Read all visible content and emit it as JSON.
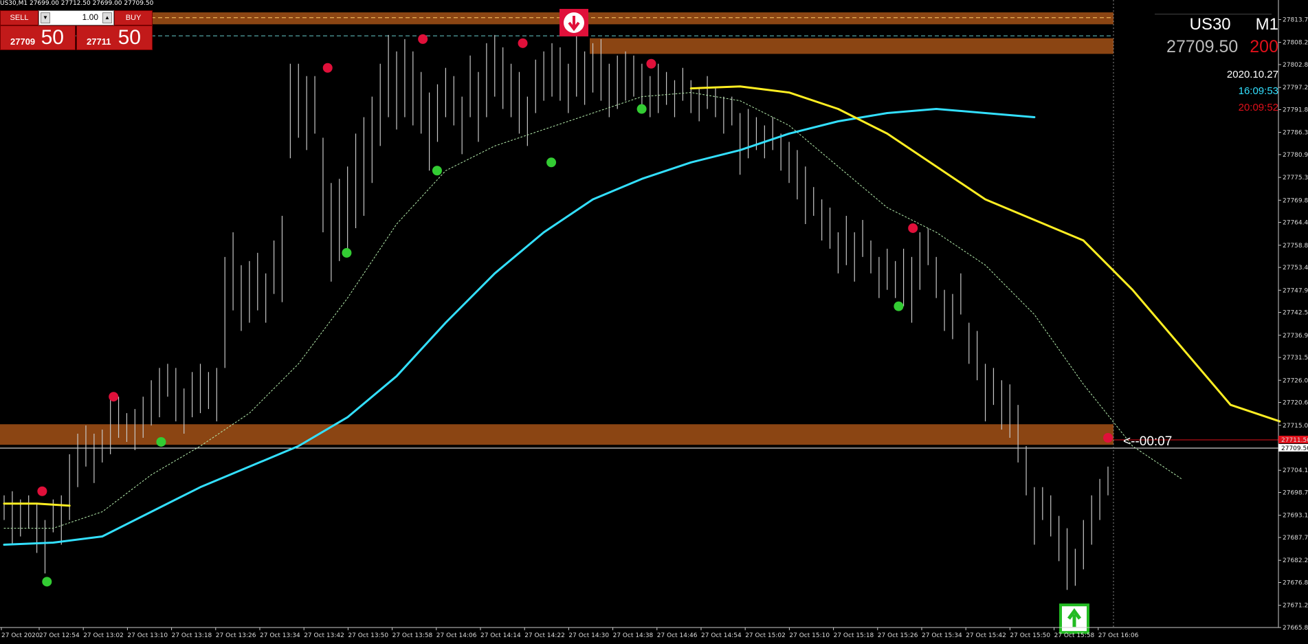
{
  "header": {
    "info_line": "US30,M1  27699.00 27712.50 27699.00 27709.50"
  },
  "trade_panel": {
    "sell_label": "SELL",
    "buy_label": "BUY",
    "lot_value": "1.00",
    "bid_small": "27709",
    "bid_big": "50",
    "ask_small": "27711",
    "ask_big": "50"
  },
  "symbol_info": {
    "symbol": "US30",
    "timeframe": "M1",
    "price": "27709.50",
    "spread": "200",
    "date": "2020.10.27",
    "time_server": "16:09:53",
    "time_local": "20:09:52"
  },
  "countdown": "<--00:07",
  "colors": {
    "background": "#000000",
    "zone": "#8b4513",
    "fast_ma": "#33e0ff",
    "slow_ma": "#ffee22",
    "dotted_ma": "#b8f0b0",
    "buy_dot": "#33cc33",
    "sell_dot": "#e0103a",
    "bars": "#c8c8c8"
  },
  "chart_data": {
    "type": "bar",
    "title": "",
    "ylim": [
      27665.85,
      27815.5
    ],
    "y_ticks": [
      "27813.75",
      "27808.20",
      "27802.80",
      "27797.25",
      "27791.85",
      "27786.30",
      "27780.90",
      "27775.35",
      "27769.80",
      "27764.40",
      "27758.85",
      "27753.45",
      "27747.90",
      "27742.50",
      "27736.95",
      "27731.55",
      "27726.00",
      "27720.60",
      "27715.05",
      "27709.50",
      "27704.10",
      "27698.70",
      "27693.15",
      "27687.75",
      "27682.20",
      "27676.80",
      "27671.25",
      "27665.85"
    ],
    "x_labels": [
      "27 Oct 2020",
      "27 Oct 12:54",
      "27 Oct 13:02",
      "27 Oct 13:10",
      "27 Oct 13:18",
      "27 Oct 13:26",
      "27 Oct 13:34",
      "27 Oct 13:42",
      "27 Oct 13:50",
      "27 Oct 13:58",
      "27 Oct 14:06",
      "27 Oct 14:14",
      "27 Oct 14:22",
      "27 Oct 14:30",
      "27 Oct 14:38",
      "27 Oct 14:46",
      "27 Oct 14:54",
      "27 Oct 15:02",
      "27 Oct 15:10",
      "27 Oct 15:18",
      "27 Oct 15:26",
      "27 Oct 15:34",
      "27 Oct 15:42",
      "27 Oct 15:50",
      "27 Oct 15:58",
      "27 Oct 16:06"
    ],
    "current_price": 27709.5,
    "ask_price": 27711.5,
    "zones": [
      [
        27812.6,
        27815.5
      ],
      [
        27805.4,
        27809.2
      ],
      [
        27710.3,
        27715.3
      ]
    ],
    "dashed_lines": [
      27814.2,
      27809.8
    ],
    "bar_ranges": [
      [
        27692,
        27698
      ],
      [
        27686,
        27699
      ],
      [
        27688,
        27697
      ],
      [
        27690,
        27698
      ],
      [
        27684,
        27696
      ],
      [
        27679,
        27692
      ],
      [
        27689,
        27697
      ],
      [
        27686,
        27698
      ],
      [
        27692,
        27708
      ],
      [
        27700,
        27713
      ],
      [
        27705,
        27715
      ],
      [
        27701,
        27713
      ],
      [
        27706,
        27714
      ],
      [
        27708,
        27722
      ],
      [
        27712,
        27722
      ],
      [
        27711,
        27718
      ],
      [
        27709,
        27719
      ],
      [
        27712,
        27722
      ],
      [
        27715,
        27726
      ],
      [
        27717,
        27729
      ],
      [
        27722,
        27730
      ],
      [
        27716,
        27729
      ],
      [
        27713,
        27724
      ],
      [
        27717,
        27728
      ],
      [
        27718,
        27730
      ],
      [
        27719,
        27728
      ],
      [
        27716,
        27729
      ],
      [
        27729,
        27756
      ],
      [
        27743,
        27762
      ],
      [
        27738,
        27754
      ],
      [
        27740,
        27755
      ],
      [
        27743,
        27757
      ],
      [
        27740,
        27752
      ],
      [
        27747,
        27760
      ],
      [
        27745,
        27766
      ],
      [
        27780,
        27803
      ],
      [
        27785,
        27803
      ],
      [
        27782,
        27800
      ],
      [
        27786,
        27800
      ],
      [
        27762,
        27785
      ],
      [
        27750,
        27774
      ],
      [
        27755,
        27775
      ],
      [
        27758,
        27778
      ],
      [
        27763,
        27786
      ],
      [
        27766,
        27790
      ],
      [
        27774,
        27795
      ],
      [
        27783,
        27803
      ],
      [
        27790,
        27810
      ],
      [
        27787,
        27806
      ],
      [
        27790,
        27809
      ],
      [
        27788,
        27806
      ],
      [
        27786,
        27801
      ],
      [
        27777,
        27796
      ],
      [
        27784,
        27798
      ],
      [
        27790,
        27802
      ],
      [
        27788,
        27800
      ],
      [
        27781,
        27795
      ],
      [
        27790,
        27805
      ],
      [
        27784,
        27801
      ],
      [
        27790,
        27808
      ],
      [
        27795,
        27810
      ],
      [
        27792,
        27807
      ],
      [
        27790,
        27803
      ],
      [
        27786,
        27801
      ],
      [
        27783,
        27795
      ],
      [
        27791,
        27804
      ],
      [
        27794,
        27806
      ],
      [
        27795,
        27808
      ],
      [
        27794,
        27807
      ],
      [
        27791,
        27803
      ],
      [
        27795,
        27810
      ],
      [
        27793,
        27806
      ],
      [
        27796,
        27808
      ],
      [
        27794,
        27809
      ],
      [
        27790,
        27803
      ],
      [
        27792,
        27805
      ],
      [
        27794,
        27806
      ],
      [
        27795,
        27805
      ],
      [
        27792,
        27803
      ],
      [
        27790,
        27800
      ],
      [
        27791,
        27803
      ],
      [
        27793,
        27801
      ],
      [
        27790,
        27799
      ],
      [
        27794,
        27802
      ],
      [
        27791,
        27799
      ],
      [
        27789,
        27797
      ],
      [
        27792,
        27800
      ],
      [
        27790,
        27797
      ],
      [
        27786,
        27795
      ],
      [
        27788,
        27795
      ],
      [
        27776,
        27791
      ],
      [
        27780,
        27792
      ],
      [
        27782,
        27790
      ],
      [
        27780,
        27788
      ],
      [
        27782,
        27790
      ],
      [
        27777,
        27786
      ],
      [
        27774,
        27784
      ],
      [
        27770,
        27782
      ],
      [
        27764,
        27778
      ],
      [
        27766,
        27773
      ],
      [
        27760,
        27770
      ],
      [
        27758,
        27768
      ],
      [
        27752,
        27762
      ],
      [
        27754,
        27766
      ],
      [
        27750,
        27762
      ],
      [
        27756,
        27765
      ],
      [
        27752,
        27760
      ],
      [
        27746,
        27756
      ],
      [
        27748,
        27758
      ],
      [
        27746,
        27755
      ],
      [
        27744,
        27758
      ],
      [
        27740,
        27756
      ],
      [
        27748,
        27762
      ],
      [
        27754,
        27763
      ],
      [
        27746,
        27756
      ],
      [
        27738,
        27748
      ],
      [
        27736,
        27747
      ],
      [
        27742,
        27752
      ],
      [
        27730,
        27740
      ],
      [
        27726,
        27738
      ],
      [
        27716,
        27730
      ],
      [
        27720,
        27729
      ],
      [
        27714,
        27726
      ],
      [
        27712,
        27725
      ],
      [
        27706,
        27720
      ],
      [
        27698,
        27710
      ],
      [
        27686,
        27700
      ],
      [
        27692,
        27700
      ],
      [
        27688,
        27698
      ],
      [
        27682,
        27693
      ],
      [
        27675,
        27690
      ],
      [
        27676,
        27685
      ],
      [
        27680,
        27692
      ],
      [
        27686,
        27698
      ],
      [
        27692,
        27702
      ],
      [
        27698,
        27705
      ]
    ],
    "fast_ma_points": [
      [
        0,
        27686
      ],
      [
        6,
        27686.5
      ],
      [
        12,
        27688
      ],
      [
        18,
        27694
      ],
      [
        24,
        27700
      ],
      [
        30,
        27705
      ],
      [
        36,
        27710
      ],
      [
        42,
        27717
      ],
      [
        48,
        27727
      ],
      [
        54,
        27740
      ],
      [
        60,
        27752
      ],
      [
        66,
        27762
      ],
      [
        72,
        27770
      ],
      [
        78,
        27775
      ],
      [
        84,
        27779
      ],
      [
        90,
        27782
      ],
      [
        96,
        27786
      ],
      [
        102,
        27789
      ],
      [
        108,
        27791
      ],
      [
        114,
        27792
      ],
      [
        120,
        27791
      ],
      [
        126,
        27790
      ]
    ],
    "slow_ma_points": [
      [
        84,
        27797
      ],
      [
        90,
        27797.5
      ],
      [
        96,
        27796
      ],
      [
        102,
        27792
      ],
      [
        108,
        27786
      ],
      [
        114,
        27778
      ],
      [
        120,
        27770
      ],
      [
        126,
        27765
      ],
      [
        132,
        27760
      ],
      [
        138,
        27748
      ],
      [
        144,
        27734
      ],
      [
        150,
        27720
      ],
      [
        156,
        27716
      ]
    ],
    "slow_ma_left": [
      [
        0,
        27696
      ],
      [
        4,
        27696
      ],
      [
        8,
        27695.5
      ]
    ],
    "dotted_ma_points": [
      [
        0,
        27690
      ],
      [
        6,
        27690
      ],
      [
        12,
        27694
      ],
      [
        18,
        27703
      ],
      [
        24,
        27710
      ],
      [
        30,
        27718
      ],
      [
        36,
        27730
      ],
      [
        42,
        27746
      ],
      [
        48,
        27764
      ],
      [
        54,
        27777
      ],
      [
        60,
        27783
      ],
      [
        66,
        27787
      ],
      [
        72,
        27791
      ],
      [
        78,
        27795
      ],
      [
        84,
        27796
      ],
      [
        90,
        27794
      ],
      [
        96,
        27788
      ],
      [
        102,
        27778
      ],
      [
        108,
        27768
      ],
      [
        114,
        27762
      ],
      [
        120,
        27754
      ],
      [
        126,
        27742
      ],
      [
        132,
        27725
      ],
      [
        138,
        27710
      ],
      [
        144,
        27702
      ]
    ],
    "sell_dots": [
      [
        8,
        27699
      ],
      [
        23,
        27722
      ],
      [
        68,
        27802
      ],
      [
        88,
        27809
      ],
      [
        109,
        27808
      ],
      [
        136,
        27803
      ],
      [
        191,
        27763
      ],
      [
        232,
        27712
      ]
    ],
    "buy_dots": [
      [
        9,
        27677
      ],
      [
        33,
        27711
      ],
      [
        72,
        27757
      ],
      [
        91,
        27777
      ],
      [
        115,
        27779
      ],
      [
        134,
        27792
      ],
      [
        188,
        27744
      ]
    ],
    "arrow_down_price": 27813,
    "arrow_up_price": 27668
  }
}
